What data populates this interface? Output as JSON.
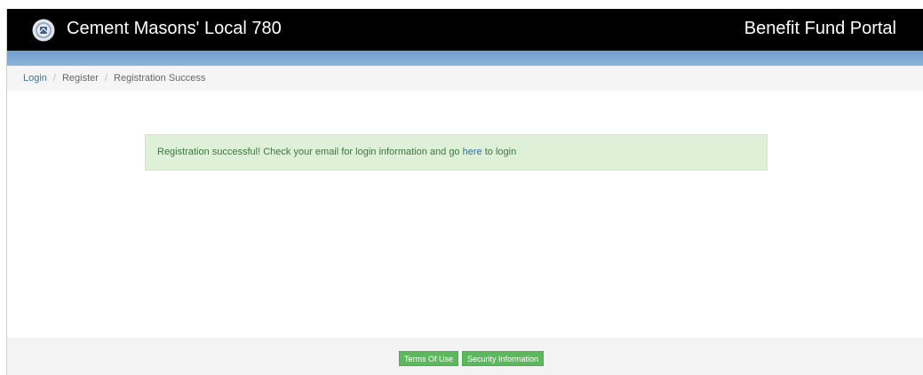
{
  "header": {
    "title": "Cement Masons' Local 780",
    "portal": "Benefit Fund Portal",
    "logo_icon": "union-seal-icon"
  },
  "breadcrumb": {
    "items": [
      "Login",
      "Register",
      "Registration Success"
    ],
    "separator": "/"
  },
  "alert": {
    "message_before": "Registration successful! Check your email for login information and go ",
    "link": "here",
    "message_after": " to login"
  },
  "footer": {
    "terms_label": "Terms Of Use",
    "security_label": "Security Information"
  },
  "colors": {
    "header_bg": "#000000",
    "accent": "#7aa7d3",
    "alert_bg": "#dff0d8",
    "alert_text": "#3c763d",
    "link": "#337ab7",
    "button": "#5cb85c"
  }
}
